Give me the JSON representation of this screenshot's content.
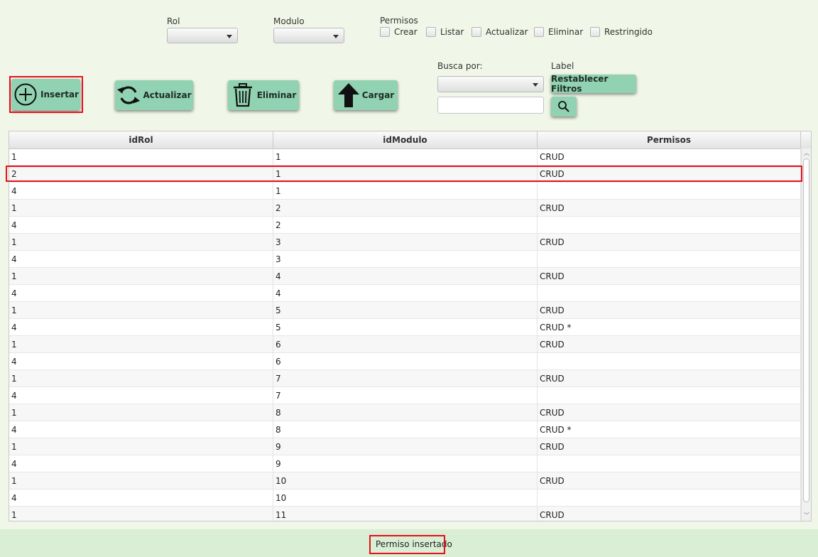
{
  "filters": {
    "rol_label": "Rol",
    "modulo_label": "Modulo",
    "permisos_label": "Permisos",
    "permisos": [
      "Crear",
      "Listar",
      "Actualizar",
      "Eliminar",
      "Restringido"
    ]
  },
  "toolbar": {
    "insertar": "Insertar",
    "actualizar": "Actualizar",
    "eliminar": "Eliminar",
    "cargar": "Cargar"
  },
  "search": {
    "busca_por_label": "Busca por:",
    "label_label": "Label",
    "restablecer": "Restablecer Filtros"
  },
  "table": {
    "columns": [
      "idRol",
      "idModulo",
      "Permisos"
    ],
    "rows": [
      [
        "1",
        "1",
        "CRUD"
      ],
      [
        "2",
        "1",
        "CRUD"
      ],
      [
        "4",
        "1",
        ""
      ],
      [
        "1",
        "2",
        "CRUD"
      ],
      [
        "4",
        "2",
        ""
      ],
      [
        "1",
        "3",
        "CRUD"
      ],
      [
        "4",
        "3",
        ""
      ],
      [
        "1",
        "4",
        "CRUD"
      ],
      [
        "4",
        "4",
        ""
      ],
      [
        "1",
        "5",
        "CRUD"
      ],
      [
        "4",
        "5",
        "CRUD *"
      ],
      [
        "1",
        "6",
        "CRUD"
      ],
      [
        "4",
        "6",
        ""
      ],
      [
        "1",
        "7",
        "CRUD"
      ],
      [
        "4",
        "7",
        ""
      ],
      [
        "1",
        "8",
        "CRUD"
      ],
      [
        "4",
        "8",
        "CRUD *"
      ],
      [
        "1",
        "9",
        "CRUD"
      ],
      [
        "4",
        "9",
        ""
      ],
      [
        "1",
        "10",
        "CRUD"
      ],
      [
        "4",
        "10",
        ""
      ],
      [
        "1",
        "11",
        "CRUD"
      ]
    ]
  },
  "status": {
    "message": "Permiso insertado"
  },
  "colors": {
    "background": "#f1f7e8",
    "button": "#90d2b1",
    "highlight": "#e8101a",
    "status_bar": "#d9eed4"
  },
  "icons": {
    "insertar": "plus-circle-icon",
    "actualizar": "refresh-icon",
    "eliminar": "trash-icon",
    "cargar": "arrow-up-icon",
    "buscar": "search-icon"
  }
}
